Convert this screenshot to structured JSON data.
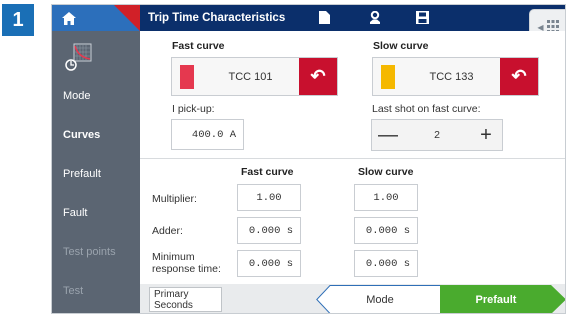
{
  "step": "1",
  "header": {
    "title": "Trip Time Characteristics",
    "icons": [
      "home-icon",
      "new-file-icon",
      "person-icon",
      "save-icon",
      "grid-icon"
    ]
  },
  "sidebar": {
    "items": [
      {
        "label": "Mode",
        "state": "normal"
      },
      {
        "label": "Curves",
        "state": "active"
      },
      {
        "label": "Prefault",
        "state": "normal"
      },
      {
        "label": "Fault",
        "state": "normal"
      },
      {
        "label": "Test points",
        "state": "disabled"
      },
      {
        "label": "Test",
        "state": "disabled"
      }
    ]
  },
  "fast": {
    "heading": "Fast curve",
    "curve": "TCC 101",
    "color": "#e5384f",
    "pickup_label": "I pick-up:",
    "pickup_value": "400.0 A"
  },
  "slow": {
    "heading": "Slow curve",
    "curve": "TCC 133",
    "color": "#f5b800",
    "lastshot_label": "Last shot on fast curve:",
    "lastshot_value": "2",
    "minus": "—",
    "plus": "+"
  },
  "table": {
    "col_fast": "Fast curve",
    "col_slow": "Slow curve",
    "multiplier_label": "Multiplier:",
    "multiplier_fast": "1.00",
    "multiplier_slow": "1.00",
    "adder_label": "Adder:",
    "adder_fast": "0.000 s",
    "adder_slow": "0.000 s",
    "minresp_label_1": "Minimum",
    "minresp_label_2": "response time:",
    "minresp_fast": "0.000 s",
    "minresp_slow": "0.000 s"
  },
  "footer": {
    "units_line1": "Primary",
    "units_line2": "Seconds",
    "back_label": "Mode",
    "next_label": "Prefault"
  },
  "colors": {
    "header": "#0b2f6b",
    "home_tab": "#2c6fbb",
    "accent_red": "#c8102e",
    "sidebar": "#5b6572",
    "next_green": "#4aab2e"
  }
}
